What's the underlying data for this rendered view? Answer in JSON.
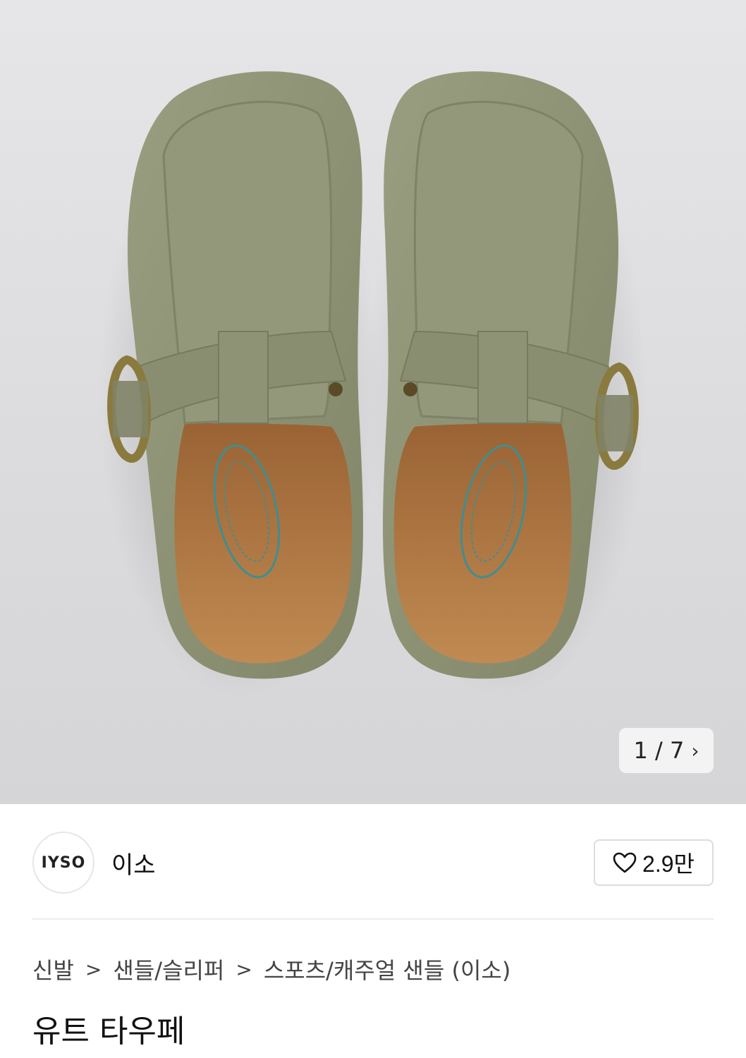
{
  "gallery": {
    "current": "1",
    "separator": "/",
    "total": "7",
    "next_icon": "chevron-right-icon"
  },
  "brand": {
    "logo_text": "IYSO",
    "name": "이소"
  },
  "like": {
    "icon": "heart-icon",
    "count": "2.9만"
  },
  "breadcrumb": {
    "items": [
      "신발",
      "샌들/슬리퍼",
      "스포츠/캐주얼 샌들 (이소)"
    ],
    "separator": ">"
  },
  "product": {
    "title": "유트 타우페"
  },
  "colors": {
    "suede": "#8e9275",
    "footbed": "#b07a45",
    "buckle": "#8a7a3e",
    "background": "#dedee0"
  }
}
